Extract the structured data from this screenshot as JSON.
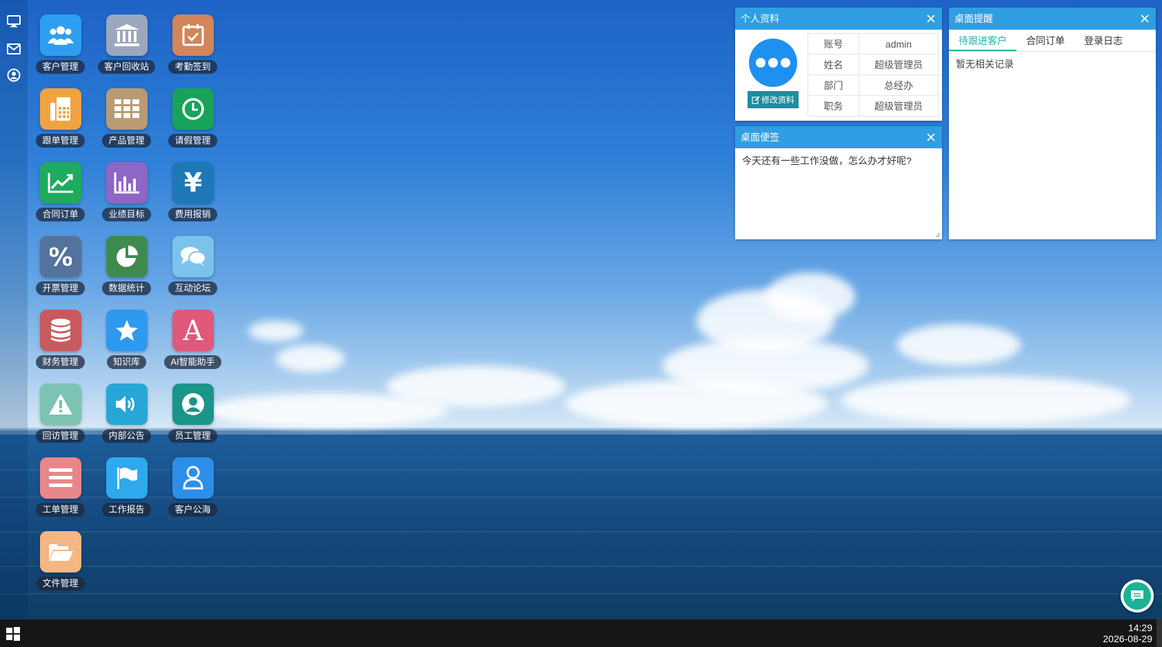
{
  "desktop": {
    "apps": [
      {
        "label": "客户管理",
        "icon": "users-icon",
        "color": "#2e9ff0"
      },
      {
        "label": "客户回收站",
        "icon": "bank-icon",
        "color": "#9ba7be"
      },
      {
        "label": "考勤签到",
        "icon": "calendar-check-icon",
        "color": "#d2865a"
      },
      {
        "label": "跟单管理",
        "icon": "fax-icon",
        "color": "#f2a341"
      },
      {
        "label": "产品管理",
        "icon": "grid-icon",
        "color": "#b99a73"
      },
      {
        "label": "请假管理",
        "icon": "clock-icon",
        "color": "#18a35a"
      },
      {
        "label": "合同订单",
        "icon": "line-chart-icon",
        "color": "#1eab5e"
      },
      {
        "label": "业绩目标",
        "icon": "bar-chart-icon",
        "color": "#8e66c6"
      },
      {
        "label": "费用报销",
        "icon": "yen-icon",
        "color": "#1d78b8"
      },
      {
        "label": "开票管理",
        "icon": "percent-icon",
        "color": "#54739c"
      },
      {
        "label": "数据统计",
        "icon": "pie-chart-icon",
        "color": "#3f8a50"
      },
      {
        "label": "互动论坛",
        "icon": "chat-bubbles-icon",
        "color": "#7cc3ec"
      },
      {
        "label": "财务管理",
        "icon": "database-icon",
        "color": "#c75a5f"
      },
      {
        "label": "知识库",
        "icon": "star-icon",
        "color": "#2f98ef"
      },
      {
        "label": "AI智能助手",
        "icon": "letter-a-icon",
        "color": "#e0587a",
        "glyph": "A"
      },
      {
        "label": "回访管理",
        "icon": "warning-icon",
        "color": "#7dc3b3"
      },
      {
        "label": "内部公告",
        "icon": "speaker-icon",
        "color": "#27a6d8"
      },
      {
        "label": "员工管理",
        "icon": "user-circle-icon",
        "color": "#19958a"
      },
      {
        "label": "工单管理",
        "icon": "list-icon",
        "color": "#e88789"
      },
      {
        "label": "工作报告",
        "icon": "flag-icon",
        "color": "#2ea9ee"
      },
      {
        "label": "客户公海",
        "icon": "user-outline-icon",
        "color": "#2b8fea"
      },
      {
        "label": "文件管理",
        "icon": "folder-open-icon",
        "color": "#f4b682"
      }
    ]
  },
  "profile": {
    "title": "个人资料",
    "edit_label": "修改资料",
    "rows": [
      {
        "key": "账号",
        "value": "admin"
      },
      {
        "key": "姓名",
        "value": "超级管理员"
      },
      {
        "key": "部门",
        "value": "总经办"
      },
      {
        "key": "职务",
        "value": "超级管理员"
      }
    ]
  },
  "note": {
    "title": "桌面便签",
    "text": "今天还有一些工作没做，怎么办才好呢?"
  },
  "reminder": {
    "title": "桌面提醒",
    "tabs": [
      "待跟进客户",
      "合同订单",
      "登录日志"
    ],
    "empty_text": "暂无相关记录"
  },
  "taskbar": {
    "time": "14:29",
    "date": "2026-08-29"
  }
}
